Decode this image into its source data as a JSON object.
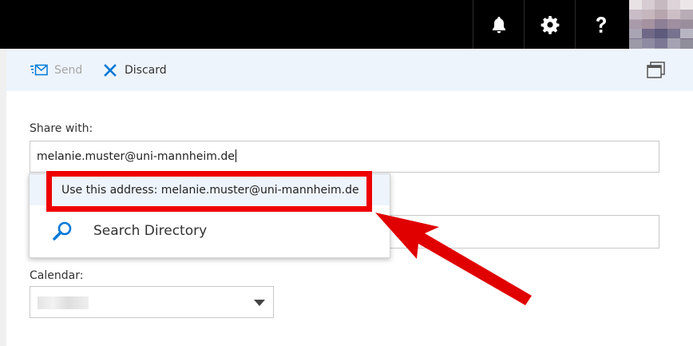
{
  "topbar": {
    "icons": [
      "bell-icon",
      "gear-icon",
      "help-icon"
    ]
  },
  "toolbar": {
    "send_label": "Send",
    "discard_label": "Discard",
    "send_icon": "send-mail-icon",
    "discard_icon": "close-icon",
    "popout_icon": "popout-window-icon"
  },
  "share": {
    "label": "Share with:",
    "value": "melanie.muster@uni-mannheim.de"
  },
  "suggestions": {
    "use_address": "Use this address: melanie.muster@uni-mannheim.de",
    "search_directory": "Search Directory"
  },
  "calendar": {
    "label": "Calendar:"
  },
  "colors": {
    "accent": "#0078d7",
    "highlight": "#e00000",
    "topbar": "#000000",
    "toolbar_bg": "#eef4fb"
  }
}
